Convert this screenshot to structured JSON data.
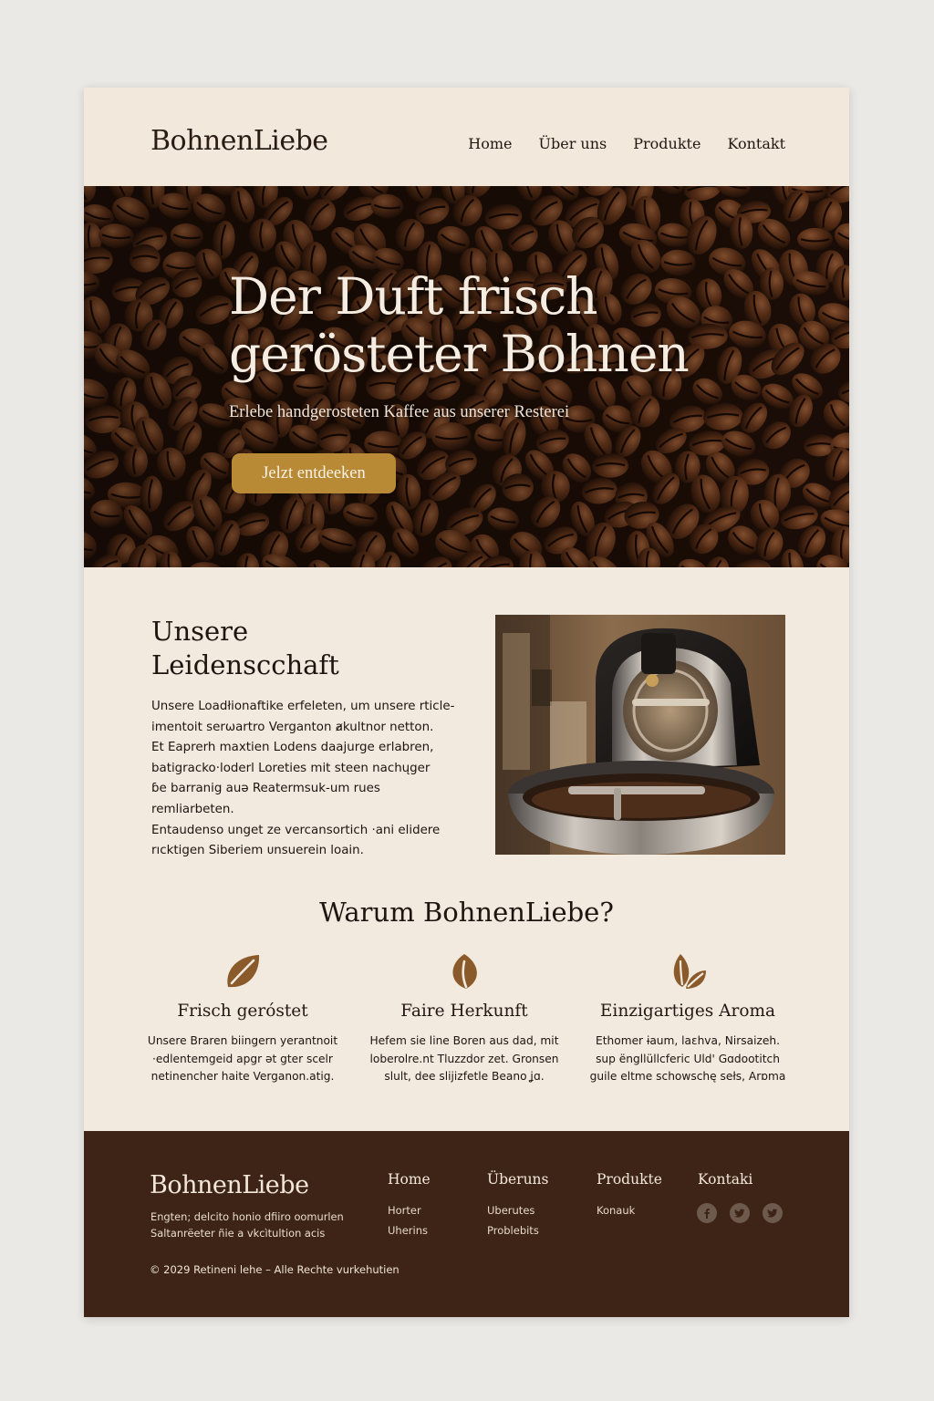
{
  "colors": {
    "page_background": "#f2e9df",
    "accent": "#b98a36",
    "icon_brown": "#8a5a2b",
    "footer_background": "#3d2416",
    "text_dark": "#1f1510"
  },
  "header": {
    "logo": "BohnenLiebe",
    "nav": [
      "Home",
      "Über uns",
      "Produkte",
      "Kontakt"
    ]
  },
  "hero": {
    "title": "Der Duft frisch gerösteter Bohnen",
    "subtitle": "Erlebe handgerosteten Kaffee aus unserer Resterei",
    "button": "Jelzt entdeeken"
  },
  "passion": {
    "title": "Unsere Leidenscchaft",
    "text": "Unsere Loadłionaftike erfeleten, um unsere rticle-\nimentoit serωartro Verganton ⱥkultnor netton.\nEt Eaprerh maxtien Lodens daajurge erlabren,\nbatigracko·loderl Loreties mit steen nachųger\nɓe barranig auə Reatermsuk-um rues remliarbeten.\nEntaudenso unget ze vercansortich ·ani elidere\nrıcktigen Siberiem ᴜnsuerein loain."
  },
  "why": {
    "title": "Warum BohnenLiebe?",
    "features": [
      {
        "icon": "leaf-icon",
        "title": "Frisch geróstet",
        "text": "Unsere Braren biingern yerantnoit\n·edlentemgeid apgr ət gter scelr\nnetinencher haite Verganon.atig."
      },
      {
        "icon": "leaf-icon",
        "title": "Faire Herkunft",
        "text": "Hefem sie line Boren aus dad, mit\nloberolre.nt Tluzzdor zet. Gronsen\nslult, dee slijizfetle Beano ʝɑ."
      },
      {
        "icon": "double-leaf-icon",
        "title": "Einzigartiges Aroma",
        "text": "Ethomer ɨaum, laɛhva, Nirsaizeh.\nsup ëngllüllcferic Uld' Gɑdootitch\nguile eltme schowschę sełs, Arɒma"
      }
    ]
  },
  "footer": {
    "logo": "BohnenLiebe",
    "description": "Engten; delcito honio dfiiro oomurlen\nSaltanrëeter ñie a vkcìtultion acis",
    "columns": [
      {
        "title": "Home",
        "links": [
          "Horter",
          "Uherins"
        ]
      },
      {
        "title": "Überuns",
        "links": [
          "Uberutes",
          "Problebits"
        ]
      },
      {
        "title": "Produkte",
        "links": [
          "Konauk"
        ]
      },
      {
        "title": "Kontaki",
        "links": []
      }
    ],
    "social": [
      "facebook-icon",
      "twitter-icon",
      "twitter-icon"
    ],
    "copyright": "© 2029 Retineni lehe – Alle Rechte vurkehutien"
  }
}
